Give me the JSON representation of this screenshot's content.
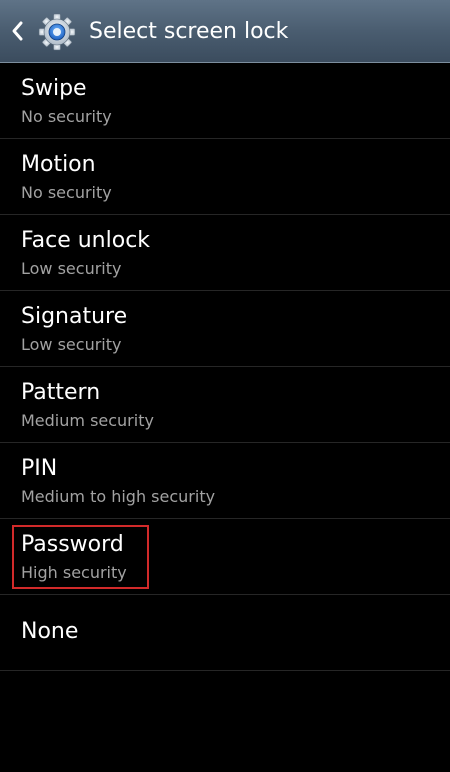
{
  "header": {
    "title": "Select screen lock",
    "back_icon": "chevron-left-icon",
    "app_icon": "gear-icon"
  },
  "lock_options": [
    {
      "label": "Swipe",
      "summary": "No security"
    },
    {
      "label": "Motion",
      "summary": "No security"
    },
    {
      "label": "Face unlock",
      "summary": "Low security"
    },
    {
      "label": "Signature",
      "summary": "Low security"
    },
    {
      "label": "Pattern",
      "summary": "Medium security"
    },
    {
      "label": "PIN",
      "summary": "Medium to high security"
    },
    {
      "label": "Password",
      "summary": "High security"
    },
    {
      "label": "None"
    }
  ],
  "colors": {
    "background": "#000000",
    "action_bar": "#4a5d70",
    "summary_text": "#a2a2a2",
    "highlight": "#d22a2a"
  }
}
